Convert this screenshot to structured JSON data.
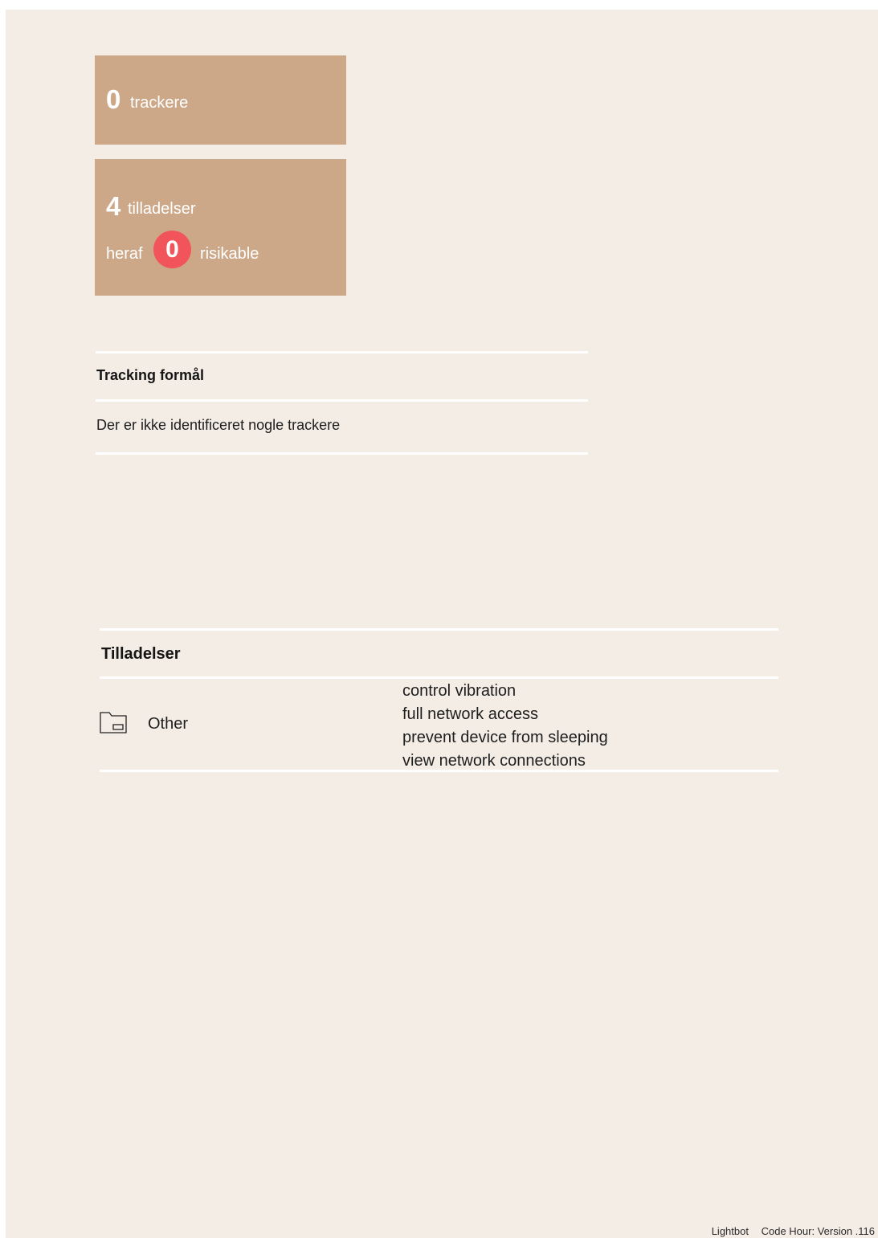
{
  "trackers_card": {
    "count": "0",
    "label": "trackere"
  },
  "permissions_card": {
    "count": "4",
    "label": "tilladelser",
    "prefix": "heraf",
    "risky_count": "0",
    "risky_label": "risikable"
  },
  "tracking_section": {
    "title": "Tracking formål",
    "empty_message": "Der er ikke identificeret nogle trackere"
  },
  "permissions_section": {
    "title": "Tilladelser",
    "groups": [
      {
        "icon": "folder-icon",
        "name": "Other",
        "items": [
          "control vibration",
          "full network access",
          "prevent device from sleeping",
          "view network connections"
        ]
      }
    ]
  },
  "footer": {
    "brand": "Lightbot",
    "version": "Code Hour: Version .116"
  },
  "colors": {
    "page_bg": "#f4ede6",
    "card_bg": "#cca889",
    "risk_badge": "#f2545b",
    "rule": "#ffffff"
  }
}
